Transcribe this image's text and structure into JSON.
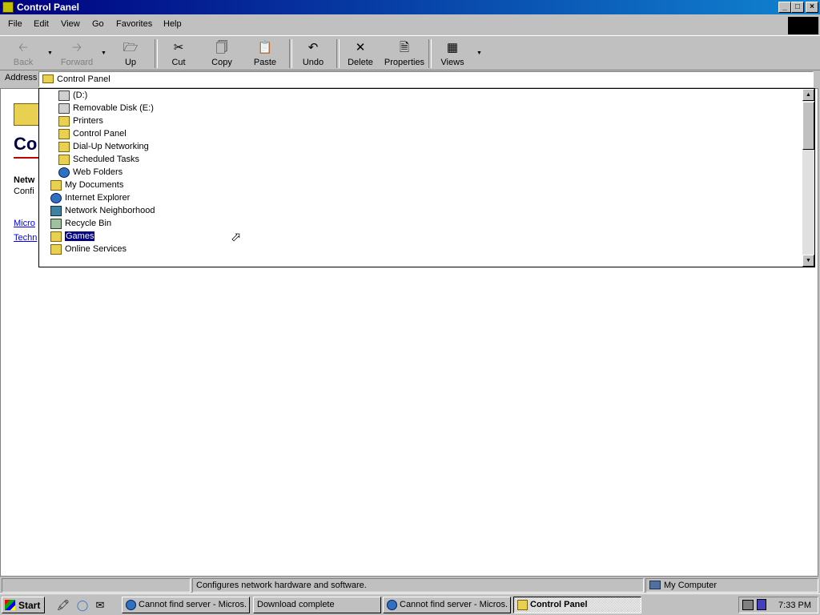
{
  "window": {
    "title": "Control Panel"
  },
  "menu": [
    {
      "label": "File"
    },
    {
      "label": "Edit"
    },
    {
      "label": "View"
    },
    {
      "label": "Go"
    },
    {
      "label": "Favorites"
    },
    {
      "label": "Help"
    }
  ],
  "toolbar": {
    "back": "Back",
    "forward": "Forward",
    "up": "Up",
    "cut": "Cut",
    "copy": "Copy",
    "paste": "Paste",
    "undo": "Undo",
    "delete": "Delete",
    "properties": "Properties",
    "views": "Views"
  },
  "address": {
    "label": "Address",
    "value": "Control Panel"
  },
  "dropdown_items": [
    {
      "label": "(D:)",
      "icon": "cd-drive-icon"
    },
    {
      "label": "Removable Disk (E:)",
      "icon": "removable-disk-icon"
    },
    {
      "label": "Printers",
      "icon": "printers-folder-icon"
    },
    {
      "label": "Control Panel",
      "icon": "control-panel-icon"
    },
    {
      "label": "Dial-Up Networking",
      "icon": "dialup-networking-icon"
    },
    {
      "label": "Scheduled Tasks",
      "icon": "scheduled-tasks-icon"
    },
    {
      "label": "Web Folders",
      "icon": "web-folders-icon"
    },
    {
      "label": "My Documents",
      "icon": "my-documents-icon"
    },
    {
      "label": "Internet Explorer",
      "icon": "internet-explorer-icon"
    },
    {
      "label": "Network Neighborhood",
      "icon": "network-neighborhood-icon"
    },
    {
      "label": "Recycle Bin",
      "icon": "recycle-bin-icon"
    },
    {
      "label": "Games",
      "icon": "folder-icon",
      "selected": true
    },
    {
      "label": "Online Services",
      "icon": "folder-icon"
    }
  ],
  "content": {
    "title": "Co",
    "selected_name": "Netw",
    "selected_desc": "Confi",
    "link1": "Micro",
    "link2": "Techn"
  },
  "statusbar": {
    "description": "Configures network hardware and software.",
    "zone": "My Computer"
  },
  "taskbar": {
    "start": "Start",
    "tasks": [
      {
        "label": "Cannot find server - Micros..."
      },
      {
        "label": "Download complete"
      },
      {
        "label": "Cannot find server - Micros..."
      },
      {
        "label": "Control Panel",
        "active": true
      }
    ],
    "clock": "7:33 PM"
  }
}
